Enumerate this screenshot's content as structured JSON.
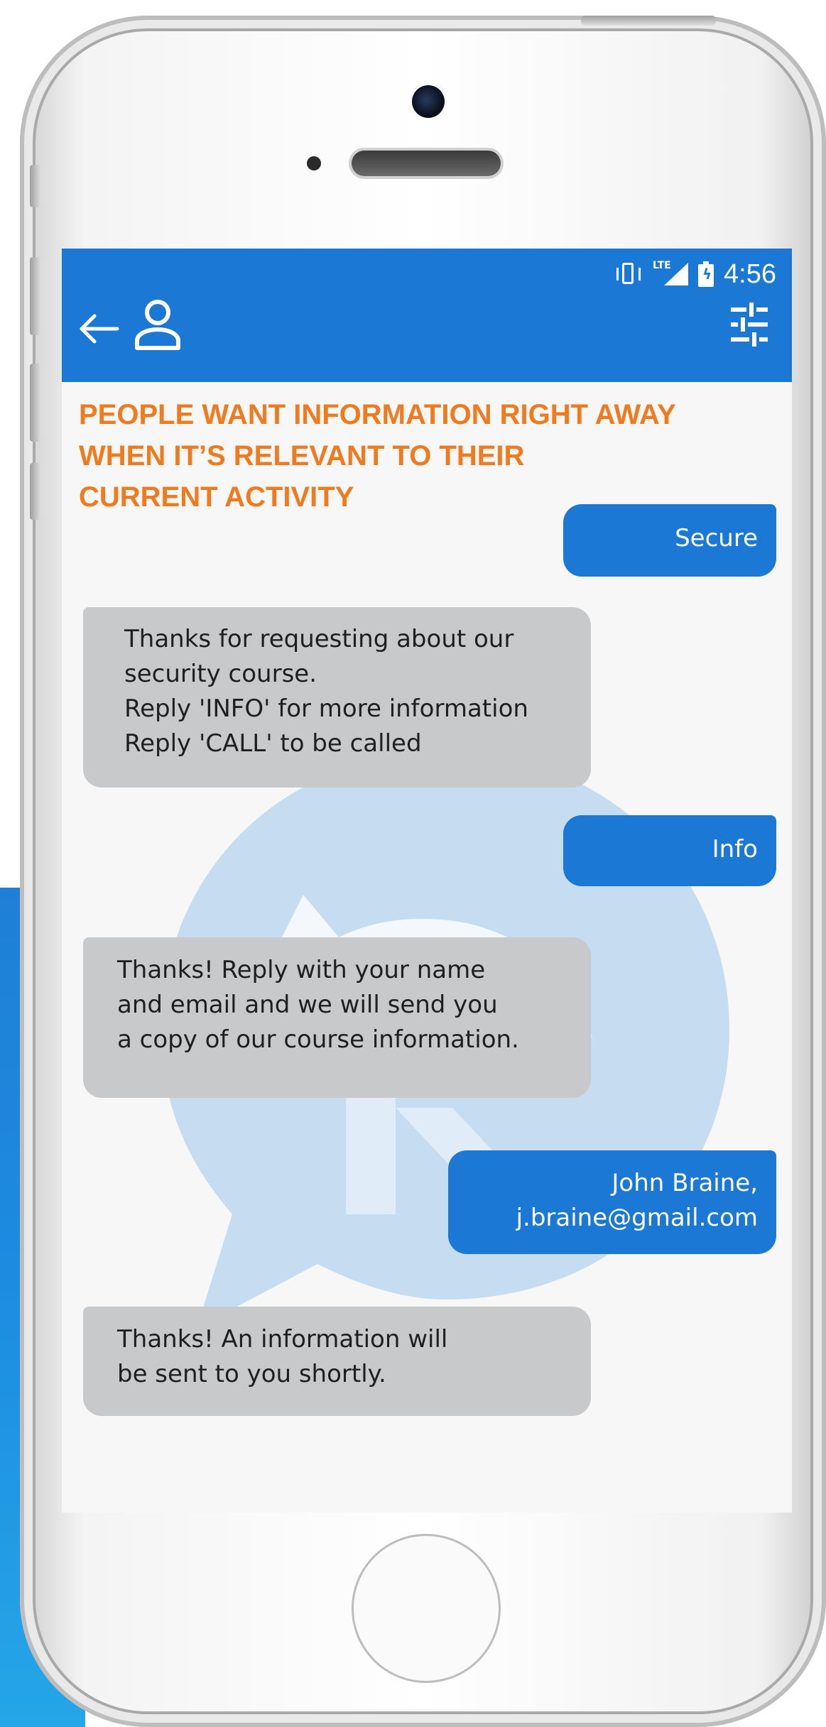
{
  "status_bar": {
    "network": "LTE",
    "time": "4:56",
    "icons": [
      "vibrate-icon",
      "signal-icon",
      "battery-charging-icon"
    ]
  },
  "app_bar": {
    "icons": [
      "back-arrow-icon",
      "person-icon",
      "tune-icon"
    ],
    "color": "#1b78d4"
  },
  "headline": {
    "lines": [
      "PEOPLE WANT INFORMATION RIGHT AWAY",
      "WHEN IT’S RELEVANT TO THEIR",
      "CURRENT ACTIVITY"
    ],
    "color": "#f07a1e"
  },
  "messages": [
    {
      "direction": "outgoing",
      "lines": [
        "Secure"
      ]
    },
    {
      "direction": "incoming",
      "lines": [
        "Thanks for requesting about our",
        "security course.",
        "Reply 'INFO' for more information",
        "Reply 'CALL' to be called"
      ]
    },
    {
      "direction": "outgoing",
      "lines": [
        "Info"
      ]
    },
    {
      "direction": "incoming",
      "lines": [
        "Thanks! Reply with your name",
        "and email and we will send you",
        "a copy of our course information."
      ]
    },
    {
      "direction": "outgoing",
      "lines": [
        "John Braine,",
        "j.braine@gmail.com"
      ]
    },
    {
      "direction": "incoming",
      "lines": [
        "Thanks! An information will",
        "be sent to you shortly."
      ]
    }
  ],
  "colors": {
    "outgoing_bubble": "#1b78d4",
    "incoming_bubble": "#c8c9cb",
    "watermark": "#c6ddf1"
  }
}
